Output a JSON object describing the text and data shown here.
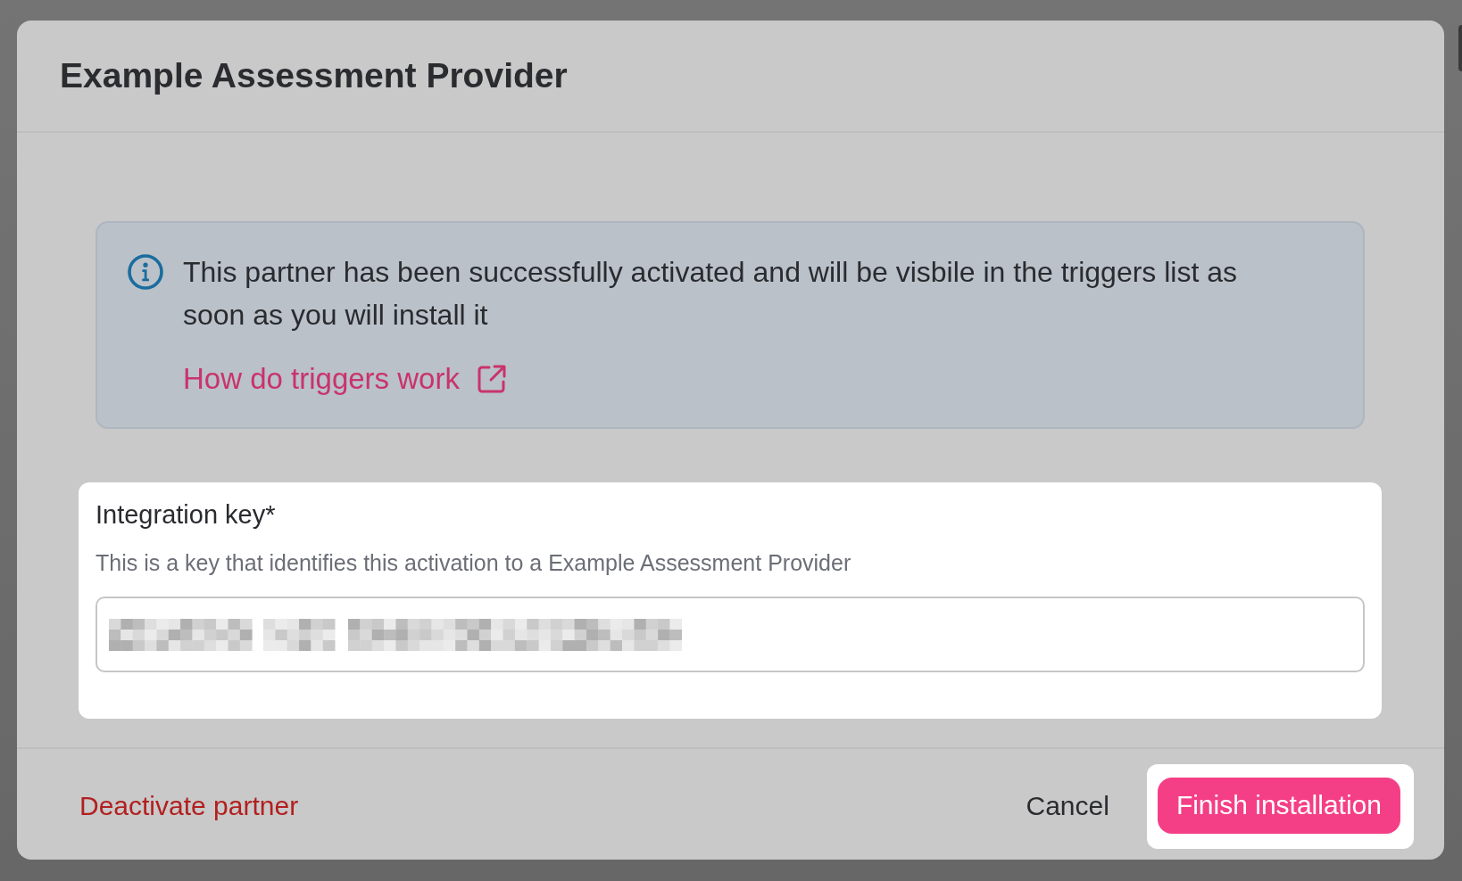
{
  "dialog": {
    "title": "Example Assessment Provider"
  },
  "info": {
    "message": "This partner has been successfully activated and will be visbile in the triggers list as soon as you will install it",
    "link": "How do triggers work"
  },
  "field": {
    "label": "Integration key*",
    "description": "This is a key that identifies this activation to a Example Assessment Provider",
    "value_obscured": true,
    "highlighted": true
  },
  "footer": {
    "danger_action": "Deactivate partner",
    "cancel": "Cancel",
    "primary": {
      "label": "Finish installation",
      "highlighted": true
    }
  }
}
